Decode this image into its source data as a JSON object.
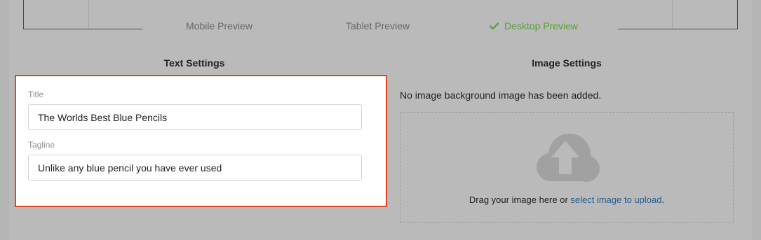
{
  "preview_tabs": {
    "mobile": "Mobile Preview",
    "tablet": "Tablet Preview",
    "desktop": "Desktop Preview"
  },
  "text_settings": {
    "heading": "Text Settings",
    "title_label": "Title",
    "title_value": "The Worlds Best Blue Pencils",
    "tagline_label": "Tagline",
    "tagline_value": "Unlike any blue pencil you have ever used"
  },
  "image_settings": {
    "heading": "Image Settings",
    "empty_message": "No image background image has been added.",
    "drag_prefix": "Drag your image here or ",
    "upload_link": "select image to upload",
    "drag_suffix": "."
  },
  "colors": {
    "active_tab": "#58a039",
    "highlight_border": "#e2462b",
    "link": "#1f5e95"
  }
}
